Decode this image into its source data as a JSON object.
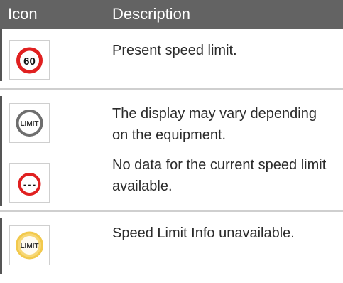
{
  "table": {
    "header": {
      "icon_col": "Icon",
      "description_col": "Description"
    },
    "rows": [
      {
        "icon_name": "speed-limit-60-icon",
        "icon_text": "60",
        "description": "Present speed limit."
      },
      {
        "icon_name": "limit-grey-icon",
        "icon_text": "LIMIT",
        "description": "The display may vary depending on the equipment."
      },
      {
        "icon_name": "no-data-speed-limit-icon",
        "icon_text": "- - -",
        "description": "No data for the current speed limit available."
      },
      {
        "icon_name": "limit-yellow-unavailable-icon",
        "icon_text": "LIMIT",
        "description": "Speed Limit Info unavailable."
      }
    ]
  },
  "colors": {
    "header_bg": "#636363",
    "sign_red": "#e02020",
    "sign_grey": "#6e6e6e",
    "sign_yellow": "#f2c94c"
  }
}
